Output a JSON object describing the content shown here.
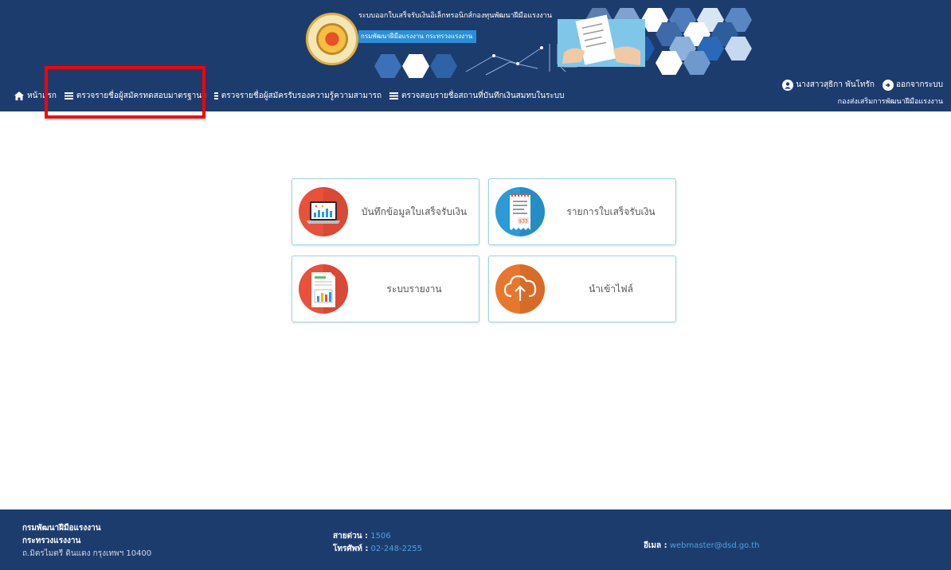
{
  "header": {
    "banner_title": "ระบบออกใบเสร็จรับเงินอิเล็กทรอนิกส์กองทุนพัฒนาฝีมือแรงงาน",
    "banner_subtitle": "กรมพัฒนาฝีมือแรงงาน กระทรวงแรงงาน",
    "nav": [
      {
        "label": "หน้าแรก",
        "icon": "home-icon"
      },
      {
        "label": "ตรวจรายชื่อผู้สมัครทดสอบมาตรฐานฯ",
        "icon": "list-icon"
      },
      {
        "label": "ตรวจรายชื่อผู้สมัครรับรองความรู้ความสามารถ",
        "icon": "list-icon"
      },
      {
        "label": "ตรวจสอบรายชื่อสถานที่บันทึกเงินสมทบในระบบ",
        "icon": "list-icon"
      }
    ],
    "user_name": "นางสาวสุธิกา พันโทรัก",
    "logout_label": "ออกจากระบบ",
    "user_department": "กองส่งเสริมการพัฒนาฝีมือแรงงาน"
  },
  "cards": [
    {
      "label": "บันทึกข้อมูลใบเสร็จรับเงิน",
      "icon": "laptop-chart-icon",
      "color": "#e8513a"
    },
    {
      "label": "รายการใบเสร็จรับเงิน",
      "icon": "receipt-icon",
      "color": "#2a9bd6"
    },
    {
      "label": "ระบบรายงาน",
      "icon": "report-icon",
      "color": "#e8513a"
    },
    {
      "label": "นำเข้าไฟล์",
      "icon": "cloud-upload-icon",
      "color": "#e8772e"
    }
  ],
  "receipt_amount": "$33",
  "footer": {
    "org_name": "กรมพัฒนาฝีมือแรงงาน",
    "ministry": "กระทรวงแรงงาน",
    "address": "ถ.มิตรไมตรี ดินแดง กรุงเทพฯ 10400",
    "hotline_label": "สายด่วน :",
    "hotline_value": "1506",
    "phone_label": "โทรศัพท์ :",
    "phone_value": "02-248-2255",
    "email_label": "อีเมล :",
    "email_value": "webmaster@dsd.go.th"
  }
}
